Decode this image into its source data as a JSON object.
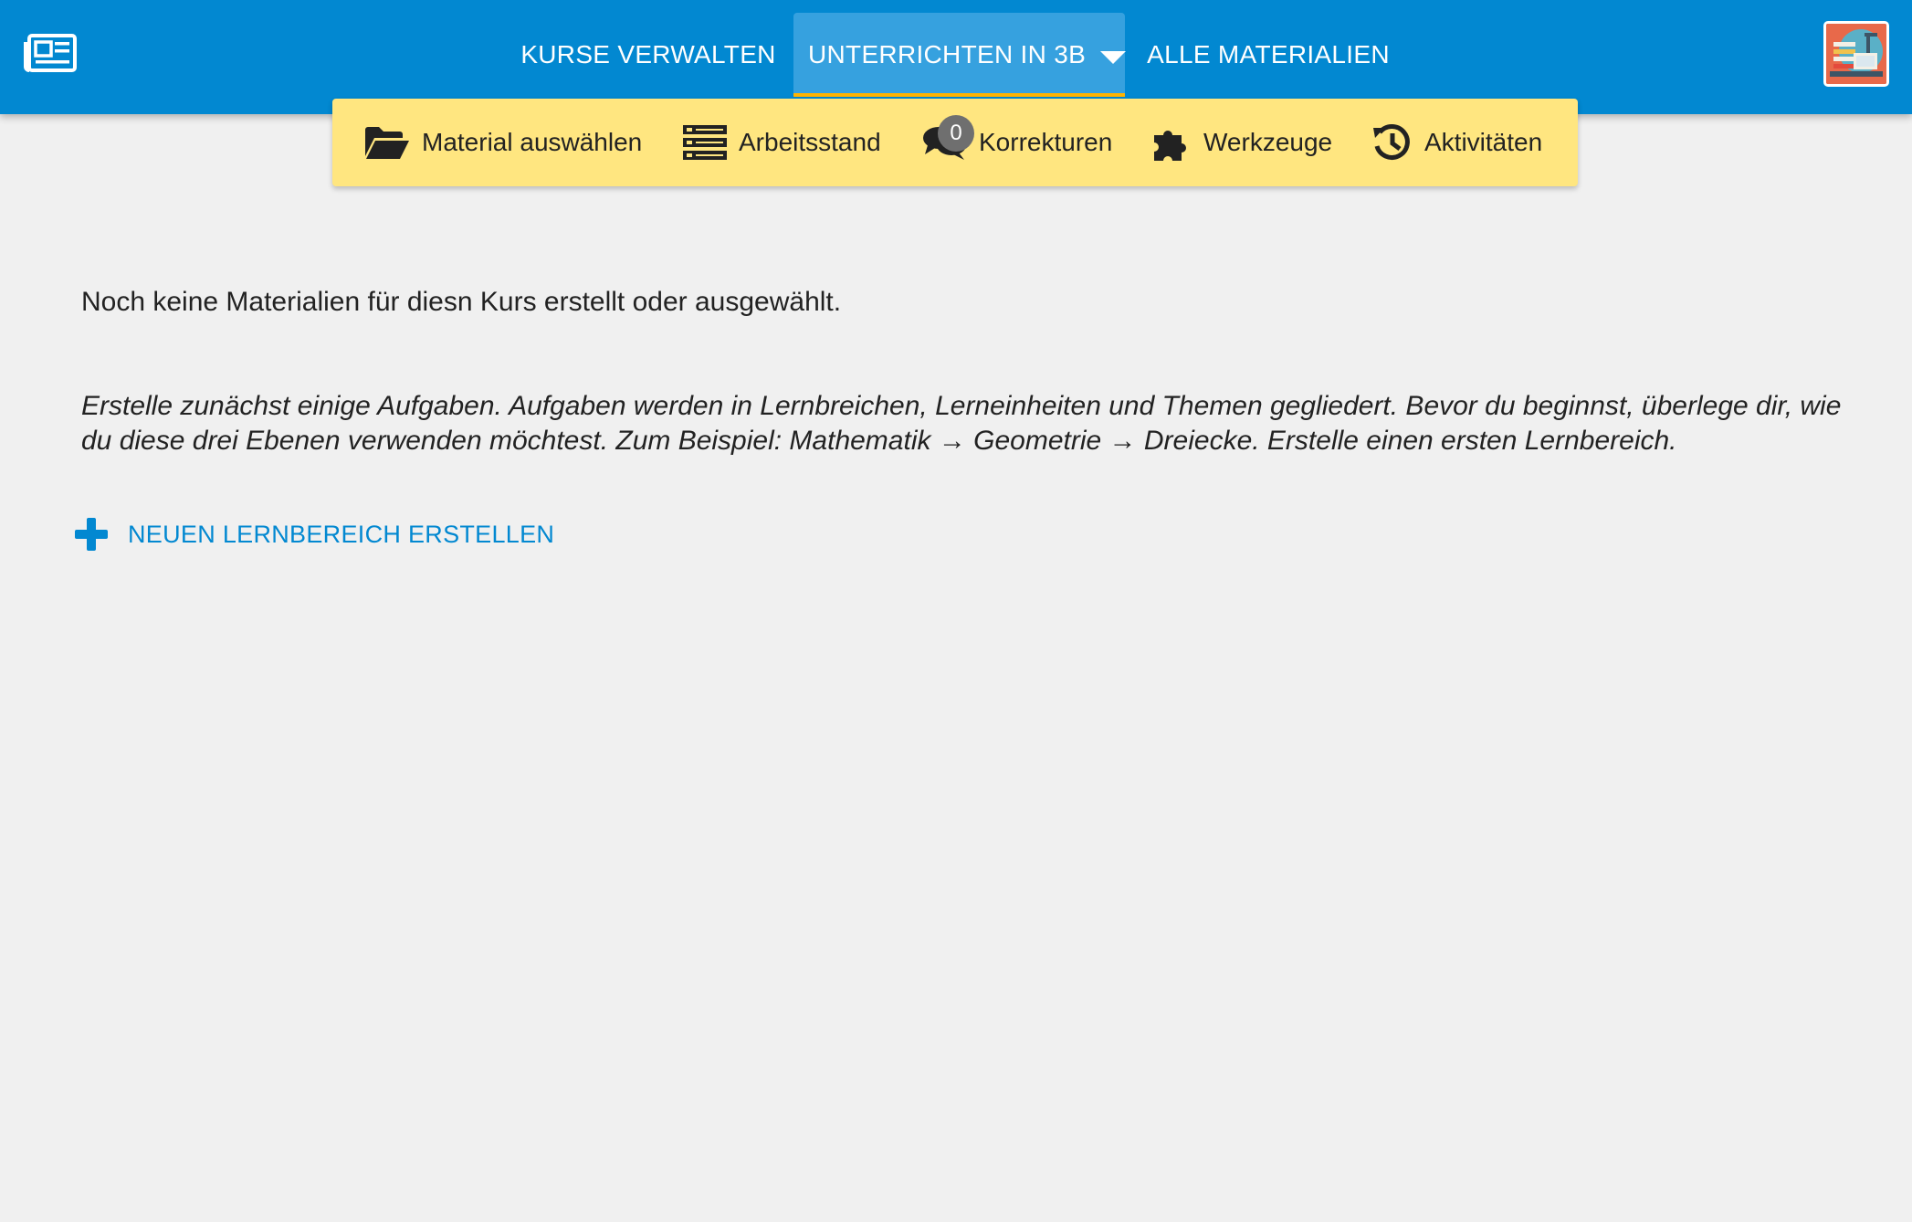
{
  "header": {
    "logo_icon": "newspaper-icon",
    "nav": [
      {
        "label": "KURSE VERWALTEN"
      },
      {
        "label": "UNTERRICHTEN IN 3B",
        "active": true
      },
      {
        "label": "ALLE MATERIALIEN"
      }
    ],
    "avatar_icon": "user-avatar"
  },
  "subnav": {
    "items": [
      {
        "label": "Material auswählen",
        "icon": "folder-open-icon"
      },
      {
        "label": "Arbeitsstand",
        "icon": "server-list-icon"
      },
      {
        "label": "Korrekturen",
        "icon": "comments-icon",
        "badge": "0"
      },
      {
        "label": "Werkzeuge",
        "icon": "puzzle-icon"
      },
      {
        "label": "Aktivitäten",
        "icon": "history-icon"
      }
    ]
  },
  "main": {
    "empty_text": "Noch keine Materialien für diesn Kurs erstellt oder ausgewählt.",
    "hint": "Erstelle zunächst einige Aufgaben. Aufgaben werden in Lernbreichen, Lerneinheiten und Themen gegliedert. Bevor du beginnst, überlege dir, wie du diese drei Ebenen verwenden möchtest. Zum Beispiel: Mathematik → Geometrie → Dreiecke. Erstelle einen ersten Lernbereich.",
    "create_button": "NEUEN LERNBEREICH ERSTELLEN"
  },
  "colors": {
    "primary": "#0288d1",
    "active_tab": "#36a1df",
    "accent": "#ffb300",
    "subnav_bg": "#ffe680",
    "background": "#f0f0f0"
  }
}
